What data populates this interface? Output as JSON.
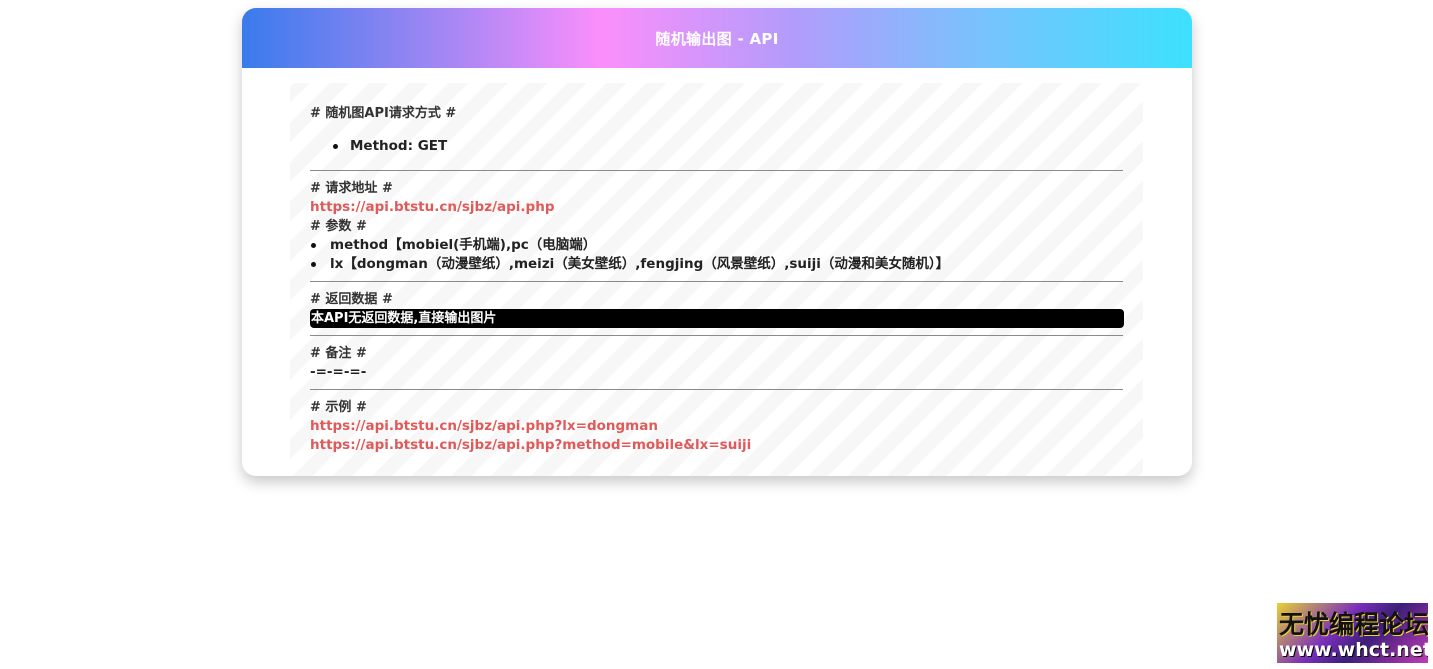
{
  "header": {
    "title": "随机输出图 - API"
  },
  "sections": {
    "method": {
      "title": "# 随机图API请求方式 #",
      "items": [
        "Method: GET"
      ]
    },
    "url": {
      "title": "# 请求地址 #",
      "link": "https://api.btstu.cn/sjbz/api.php"
    },
    "params": {
      "title": "# 参数 #",
      "items": [
        "method【mobiel(手机端),pc（电脑端）",
        "lx【dongman（动漫壁纸）,meizi（美女壁纸）,fengjing（风景壁纸）,suiji（动漫和美女随机）】"
      ]
    },
    "response": {
      "title": "# 返回数据 #",
      "code": "本API无返回数据,直接输出图片"
    },
    "notes": {
      "title": "# 备注 #",
      "text": "-=-=-=-"
    },
    "examples": {
      "title": "# 示例 #",
      "links": [
        "https://api.btstu.cn/sjbz/api.php?lx=dongman",
        "https://api.btstu.cn/sjbz/api.php?method=mobile&lx=suiji"
      ]
    }
  },
  "watermark": {
    "line1": "无忧编程论坛",
    "line2": "www.whct.net"
  }
}
